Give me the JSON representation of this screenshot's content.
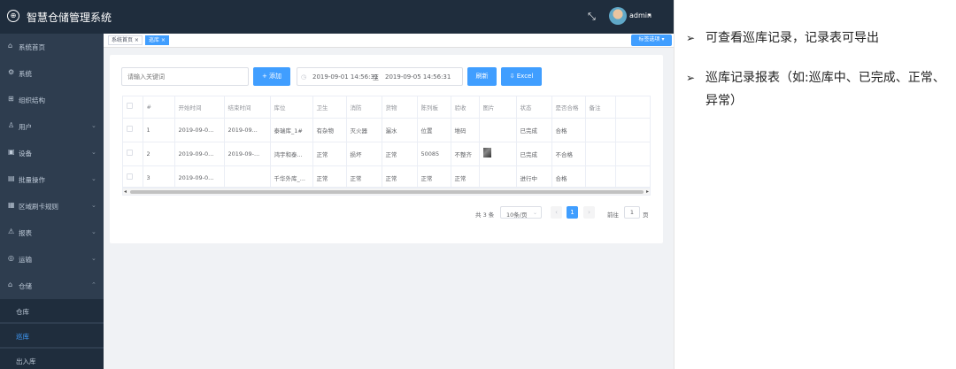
{
  "app": {
    "title": "智慧仓储管理系统",
    "logo_icon": "globe-icon"
  },
  "header": {
    "fullscreen_icon": "fullscreen-icon",
    "user": "admin",
    "user_caret": "▾"
  },
  "sidebar": {
    "items": [
      {
        "icon": "home-icon",
        "glyph": "⌂",
        "label": "系统首页",
        "arrow": ""
      },
      {
        "icon": "system-icon",
        "glyph": "⚙",
        "label": "系统",
        "arrow": ""
      },
      {
        "icon": "org-icon",
        "glyph": "⊞",
        "label": "组织结构",
        "arrow": ""
      },
      {
        "icon": "user-icon",
        "glyph": "♙",
        "label": "用户",
        "arrow": "⌄"
      },
      {
        "icon": "device-icon",
        "glyph": "▣",
        "label": "设备",
        "arrow": "⌄"
      },
      {
        "icon": "batch-icon",
        "glyph": "▤",
        "label": "批量操作",
        "arrow": "⌄"
      },
      {
        "icon": "rule-icon",
        "glyph": "▦",
        "label": "区域刷卡规则",
        "arrow": "⌄"
      },
      {
        "icon": "alarm-icon",
        "glyph": "⚠",
        "label": "报表",
        "arrow": "⌄"
      },
      {
        "icon": "transport-icon",
        "glyph": "◎",
        "label": "运输",
        "arrow": "⌄"
      },
      {
        "icon": "warehouse-icon",
        "glyph": "⌂",
        "label": "仓储",
        "arrow": "⌃"
      }
    ],
    "subitems": [
      {
        "label": "仓库",
        "active": false
      },
      {
        "label": "巡库",
        "active": true
      },
      {
        "label": "出入库",
        "active": false
      }
    ]
  },
  "tags": {
    "items": [
      {
        "label": "系统首页 ×",
        "active": false
      },
      {
        "label": "巡库 ×",
        "active": true
      }
    ],
    "menu_button": "标签选项 ▾"
  },
  "toolbar": {
    "search_placeholder": "请输入关键词",
    "add_label": "+ 添加",
    "date_icon": "◷",
    "date_start": "2019-09-01 14:56:31",
    "date_sep": "至",
    "date_end": "2019-09-05 14:56:31",
    "refresh_label": "刷新",
    "excel_label": "⇩ Excel"
  },
  "table": {
    "columns": [
      "",
      "#",
      "开始时间",
      "结束时间",
      "库位",
      "卫生",
      "消防",
      "货物",
      "陈列板",
      "验收",
      "图片",
      "状态",
      "是否合格",
      "备注",
      ""
    ],
    "rows": [
      {
        "cells": [
          "",
          "1",
          "2019-09-0...",
          "2019-09...",
          "泰瑞库_1#",
          "有杂物",
          "灭火器",
          "漏水",
          "位置",
          "堆码",
          "",
          "已完成",
          "合格",
          "",
          ""
        ],
        "status_class": "",
        "qual_class": "ok",
        "has_photo": false
      },
      {
        "cells": [
          "",
          "2",
          "2019-09-0...",
          "2019-09-...",
          "鸿宇和泰...",
          "正常",
          "损坏",
          "正常",
          "50085",
          "不整齐",
          "",
          "已完成",
          "不合格",
          "",
          ""
        ],
        "status_class": "",
        "qual_class": "bad",
        "has_photo": true
      },
      {
        "cells": [
          "",
          "3",
          "2019-09-0...",
          "",
          "千华外库_...",
          "正常",
          "正常",
          "正常",
          "正常",
          "正常",
          "",
          "进行中",
          "合格",
          "",
          ""
        ],
        "status_class": "ok",
        "qual_class": "ok",
        "has_photo": false
      }
    ]
  },
  "pagination": {
    "total": "共 3 条",
    "page_size": "10条/页",
    "size_caret": "⌄",
    "prev": "‹",
    "current": "1",
    "next": "›",
    "goto": "前往",
    "goto_value": "1",
    "page_suffix": "页"
  },
  "notes": [
    {
      "bullet": "➢",
      "text": "可查看巡库记录，记录表可导出"
    },
    {
      "bullet": "➢",
      "text": "巡库记录报表（如:巡库中、已完成、正常、异常）"
    }
  ]
}
